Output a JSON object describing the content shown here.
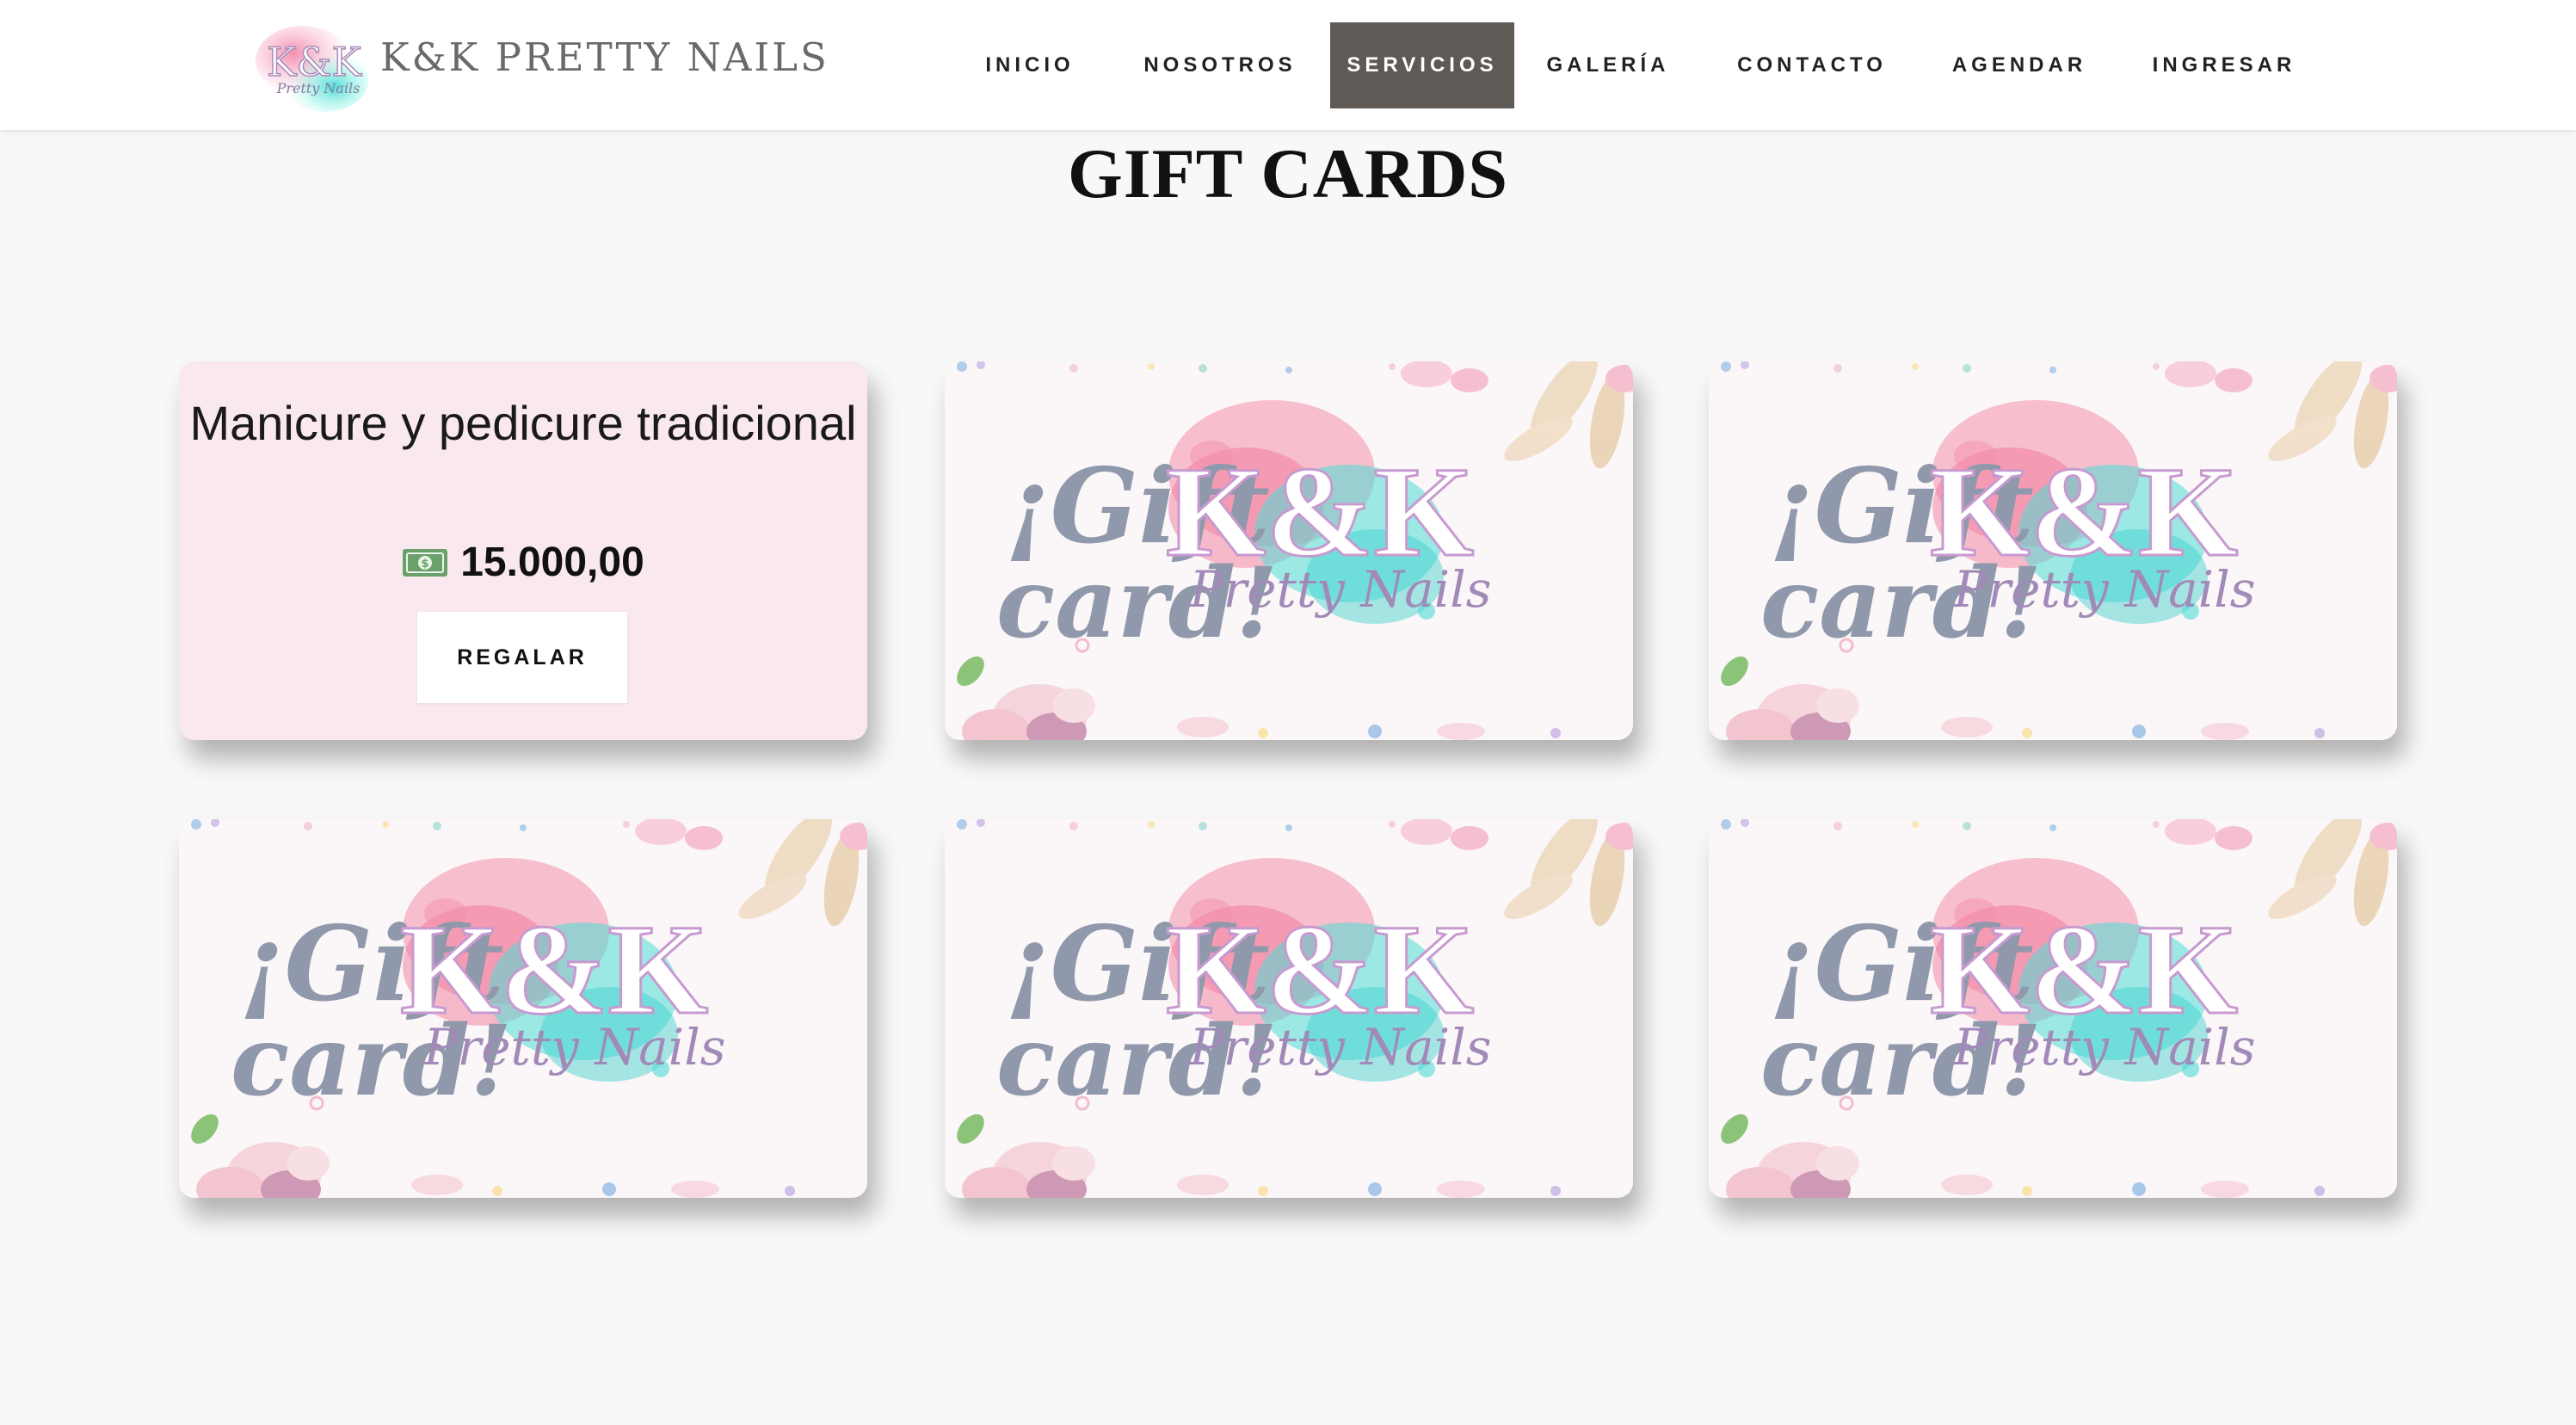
{
  "header": {
    "logo_text": "K&K",
    "logo_script": "Pretty Nails",
    "brand": "K&K PRETTY NAILS",
    "nav": [
      {
        "label": "INICIO"
      },
      {
        "label": "NOSOTROS"
      },
      {
        "label": "SERVICIOS",
        "active": true
      },
      {
        "label": "GALERÍA"
      },
      {
        "label": "CONTACTO"
      },
      {
        "label": "AGENDAR"
      },
      {
        "label": "INGRESAR"
      }
    ]
  },
  "page": {
    "title": "GIFT CARDS"
  },
  "product": {
    "name": "Manicure y pedicure tradicional",
    "price": "15.000,00",
    "price_icon": "money-bill-icon",
    "button": "REGALAR"
  },
  "gift_card": {
    "headline_1": "¡Gift",
    "headline_2": "card!",
    "logo_text": "K&K",
    "logo_script": "Pretty Nails"
  },
  "colors": {
    "nav_active_bg": "#5f5a56",
    "info_card_bg": "#f9e9ee",
    "gift_text": "#9098ab",
    "watercolor_pink": "#f08fa8",
    "watercolor_teal": "#5fe0dc"
  }
}
